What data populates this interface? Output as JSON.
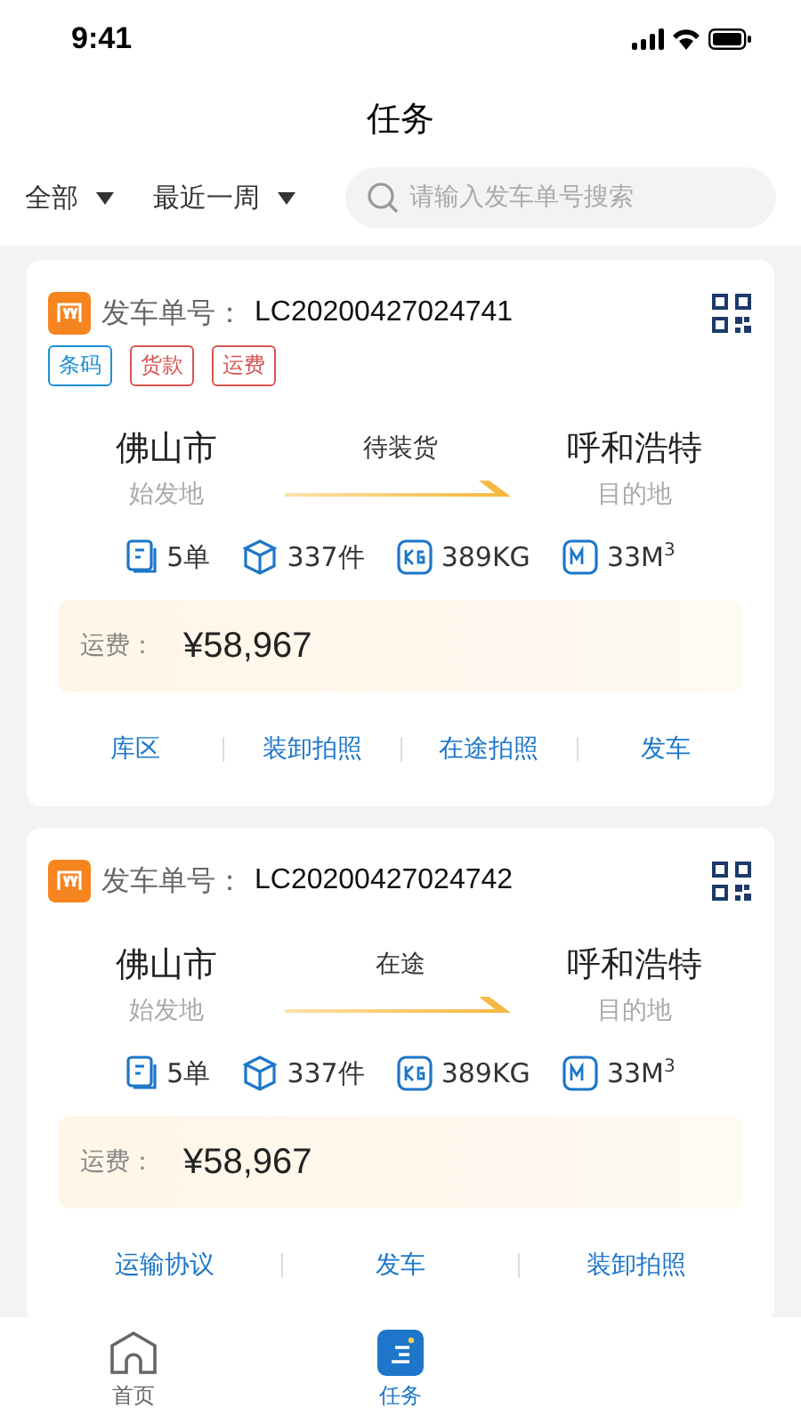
{
  "status_bar": {
    "time": "9:41"
  },
  "title": "任务",
  "filters": [
    {
      "label": "全部"
    },
    {
      "label": "最近一周"
    }
  ],
  "search": {
    "placeholder": "请输入发车单号搜索"
  },
  "orders": [
    {
      "number_label": "发车单号：",
      "number": "LC20200427024741",
      "tags": [
        {
          "label": "条码",
          "color": "#1b8fd6"
        },
        {
          "label": "货款",
          "color": "#d9534f"
        },
        {
          "label": "运费",
          "color": "#d9534f"
        }
      ],
      "origin": "佛山市",
      "origin_label": "始发地",
      "status": "待装货",
      "destination": "呼和浩特",
      "destination_label": "目的地",
      "stats": [
        {
          "kind": "orders",
          "value": "5单"
        },
        {
          "kind": "pieces",
          "value": "337件"
        },
        {
          "kind": "weight",
          "value": "389KG"
        },
        {
          "kind": "volume",
          "value": "33M$^{3}$"
        }
      ],
      "fee_label": "运费：",
      "fee": "¥58,967",
      "actions": [
        "库区",
        "装卸拍照",
        "在途拍照",
        "发车"
      ]
    },
    {
      "number_label": "发车单号：",
      "number": "LC20200427024742",
      "origin": "佛山市",
      "origin_label": "始发地",
      "status": "在途",
      "destination": "呼和浩特",
      "destination_label": "目的地",
      "stats": [
        {
          "kind": "orders",
          "value": "5单"
        },
        {
          "kind": "pieces",
          "value": "337件"
        },
        {
          "kind": "weight",
          "value": "389KG"
        },
        {
          "kind": "volume",
          "value": "33M$^{3}$"
        }
      ],
      "fee_label": "运费：",
      "fee": "¥58,967",
      "actions": [
        "运输协议",
        "发车",
        "装卸拍照"
      ]
    }
  ],
  "tab_bar": [
    {
      "kind": "home",
      "label": "首页",
      "selected": false
    },
    {
      "kind": "tasks",
      "label": "任务",
      "selected": true
    }
  ]
}
